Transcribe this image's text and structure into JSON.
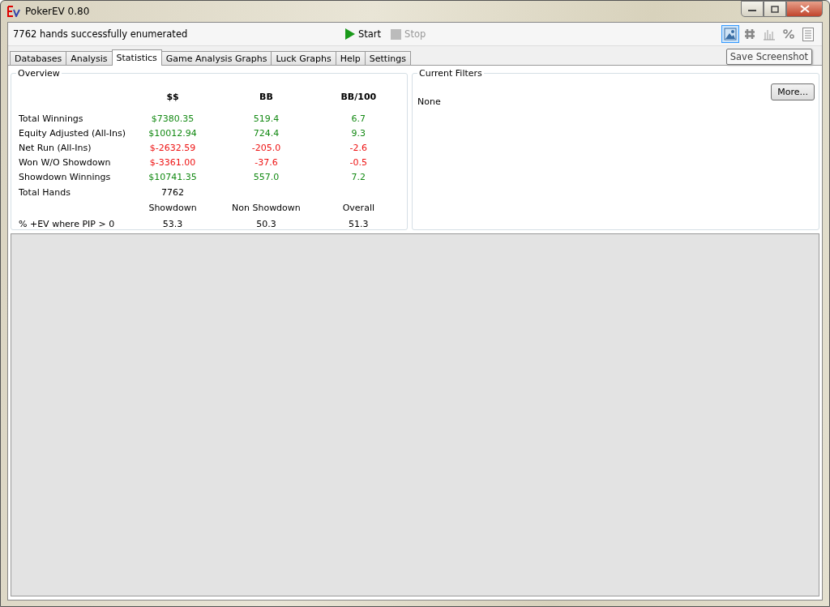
{
  "window": {
    "title": "PokerEV 0.80"
  },
  "toolbar": {
    "status": "7762 hands successfully enumerated",
    "buttons": [
      {
        "label": "Start",
        "disabled": false
      },
      {
        "label": "Stop",
        "disabled": true
      }
    ],
    "icons": [
      {
        "kind": "picture",
        "selected": true
      },
      {
        "kind": "hash",
        "selected": false
      },
      {
        "kind": "bars",
        "selected": false
      },
      {
        "kind": "percent",
        "selected": false
      },
      {
        "kind": "list",
        "selected": false
      }
    ],
    "tooltip": "Save Screenshot"
  },
  "tabs": [
    {
      "label": "Databases",
      "selected": false
    },
    {
      "label": "Analysis",
      "selected": false
    },
    {
      "label": "Statistics",
      "selected": true
    },
    {
      "label": "Game Analysis Graphs",
      "selected": false
    },
    {
      "label": "Luck Graphs",
      "selected": false
    },
    {
      "label": "Help",
      "selected": false
    },
    {
      "label": "Settings",
      "selected": false
    }
  ],
  "overview": {
    "title": "Overview",
    "columns": [
      "$$",
      "BB",
      "BB/100"
    ],
    "rows": [
      {
        "label": "Total Winnings",
        "kind": "positive",
        "values": [
          "$7380.35",
          "519.4",
          "6.7"
        ]
      },
      {
        "label": "Equity Adjusted (All-Ins)",
        "kind": "positive",
        "values": [
          "$10012.94",
          "724.4",
          "9.3"
        ]
      },
      {
        "label": "Net Run (All-Ins)",
        "kind": "negative",
        "values": [
          "$-2632.59",
          "-205.0",
          "-2.6"
        ]
      },
      {
        "label": "Won W/O Showdown",
        "kind": "negative",
        "values": [
          "$-3361.00",
          "-37.6",
          "-0.5"
        ]
      },
      {
        "label": "Showdown Winnings",
        "kind": "positive",
        "values": [
          "$10741.35",
          "557.0",
          "7.2"
        ]
      },
      {
        "label": "Total Hands",
        "kind": "plain",
        "values": [
          "7762"
        ]
      },
      {
        "label": "",
        "kind": "header",
        "values": [
          "Showdown",
          "Non Showdown",
          "Overall"
        ]
      },
      {
        "label": "% +EV where PIP > 0",
        "kind": "plain",
        "values": [
          "53.3",
          "50.3",
          "51.3"
        ]
      }
    ]
  },
  "filters": {
    "title": "Current Filters",
    "value": "None",
    "button": "More..."
  }
}
